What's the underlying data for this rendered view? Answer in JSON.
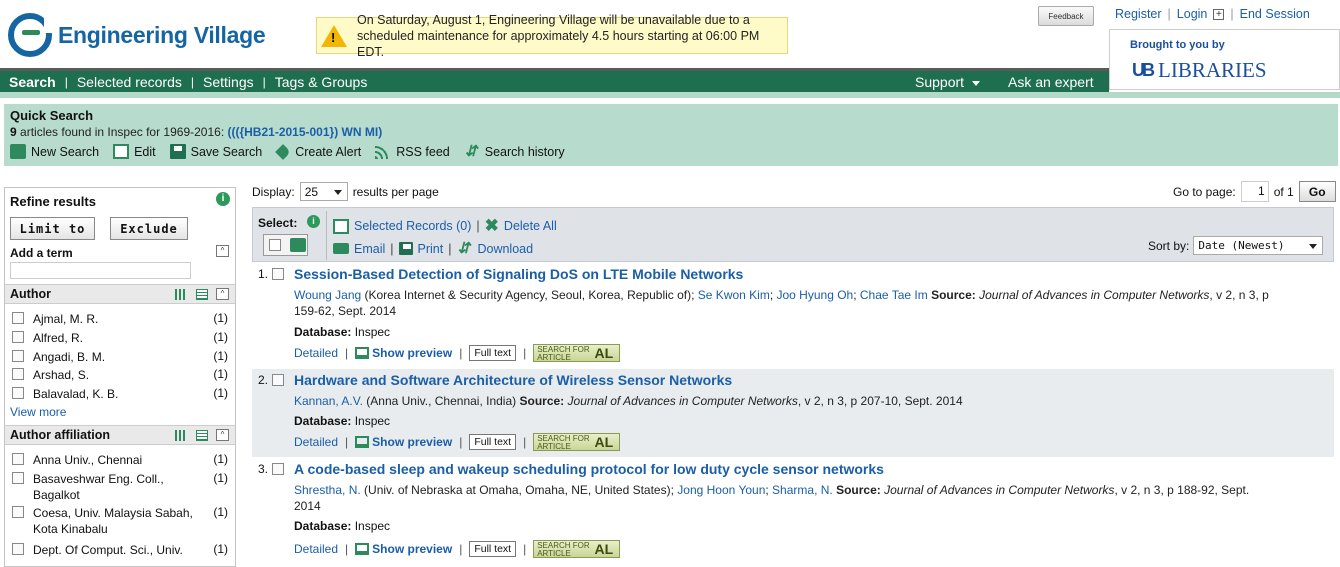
{
  "app": {
    "name": "Engineering Village"
  },
  "notice": {
    "text": "On Saturday, August 1, Engineering Village will be unavailable due to a scheduled maintenance for approximately 4.5 hours starting at 06:00 PM EDT."
  },
  "header": {
    "feedback": "Feedback",
    "register": "Register",
    "login": "Login",
    "end_session": "End Session",
    "brought_by": "Brought to you by",
    "ub": "UB",
    "libraries": "LIBRARIES"
  },
  "nav": {
    "items": [
      "Search",
      "Selected records",
      "Settings",
      "Tags & Groups"
    ],
    "support": "Support",
    "ask": "Ask an expert"
  },
  "quick_search": {
    "title": "Quick Search",
    "count": "9",
    "found_text": " articles found in Inspec for 1969-2016: ",
    "query": "((({HB21-2015-001}) WN MI)",
    "tools": [
      "New Search",
      "Edit",
      "Save Search",
      "Create Alert",
      "RSS feed",
      "Search history"
    ]
  },
  "refine": {
    "title": "Refine results",
    "limit": "Limit to",
    "exclude": "Exclude",
    "add_term": "Add a term",
    "author_title": "Author",
    "authors": [
      {
        "name": "Ajmal, M. R.",
        "count": "(1)"
      },
      {
        "name": "Alfred, R.",
        "count": "(1)"
      },
      {
        "name": "Angadi, B. M.",
        "count": "(1)"
      },
      {
        "name": "Arshad, S.",
        "count": "(1)"
      },
      {
        "name": "Balavalad, K. B.",
        "count": "(1)"
      }
    ],
    "view_more": "View more",
    "affil_title": "Author affiliation",
    "affiliations": [
      {
        "name": "Anna Univ., Chennai",
        "count": "(1)"
      },
      {
        "name": "Basaveshwar Eng. Coll., Bagalkot",
        "count": "(1)"
      },
      {
        "name": "Coesa, Univ. Malaysia Sabah, Kota Kinabalu",
        "count": "(1)"
      },
      {
        "name": "Dept. Of Comput. Sci., Univ.",
        "count": "(1)"
      }
    ]
  },
  "results": {
    "display_label": "Display:",
    "per_page": "25",
    "per_page_label": "results per page",
    "goto_label": "Go to page:",
    "page": "1",
    "of": "of 1",
    "go": "Go",
    "select_label": "Select:",
    "selected_records": "Selected Records (0)",
    "delete_all": "Delete All",
    "email": "Email",
    "print": "Print",
    "download": "Download",
    "sort_label": "Sort by:",
    "sort_value": "Date (Newest)"
  },
  "records": [
    {
      "num": "1.",
      "title": "Session-Based Detection of Signaling DoS on LTE Mobile Networks",
      "authors": [
        {
          "name": "Woung Jang",
          "affil": " (Korea Internet & Security Agency, Seoul, Korea, Republic of); "
        },
        {
          "name": "Se Kwon Kim",
          "affil": "; "
        },
        {
          "name": "Joo Hyung Oh",
          "affil": "; "
        },
        {
          "name": "Chae Tae Im",
          "affil": "  "
        }
      ],
      "source_label": "Source:",
      "journal": "Journal of Advances in Computer Networks",
      "source_rest": ", v 2, n 3, p 159-62, Sept. 2014",
      "database_label": "Database:",
      "database": "Inspec"
    },
    {
      "num": "2.",
      "title": "Hardware and Software Architecture of Wireless Sensor Networks",
      "authors": [
        {
          "name": "Kannan, A.V.",
          "affil": " (Anna Univ., Chennai, India)  "
        }
      ],
      "source_label": "Source:",
      "journal": "Journal of Advances in Computer Networks",
      "source_rest": ", v 2, n 3, p 207-10, Sept. 2014",
      "database_label": "Database:",
      "database": "Inspec"
    },
    {
      "num": "3.",
      "title": "A code-based sleep and wakeup scheduling protocol for low duty cycle sensor networks",
      "authors": [
        {
          "name": "Shrestha, N.",
          "affil": " (Univ. of Nebraska at Omaha, Omaha, NE, United States); "
        },
        {
          "name": "Jong Hoon Youn",
          "affil": "; "
        },
        {
          "name": "Sharma, N.",
          "affil": "  "
        }
      ],
      "source_label": "Source:",
      "journal": "Journal of Advances in Computer Networks",
      "source_rest": ", v 2, n 3, p 188-92, Sept. 2014",
      "database_label": "Database:",
      "database": "Inspec"
    }
  ],
  "record_links": {
    "detailed": "Detailed",
    "show_preview": "Show preview",
    "full_text": "Full text",
    "sfa_line1": "SEARCH FOR",
    "sfa_line2": "ARTICLE",
    "sfa_mark": "AL"
  }
}
